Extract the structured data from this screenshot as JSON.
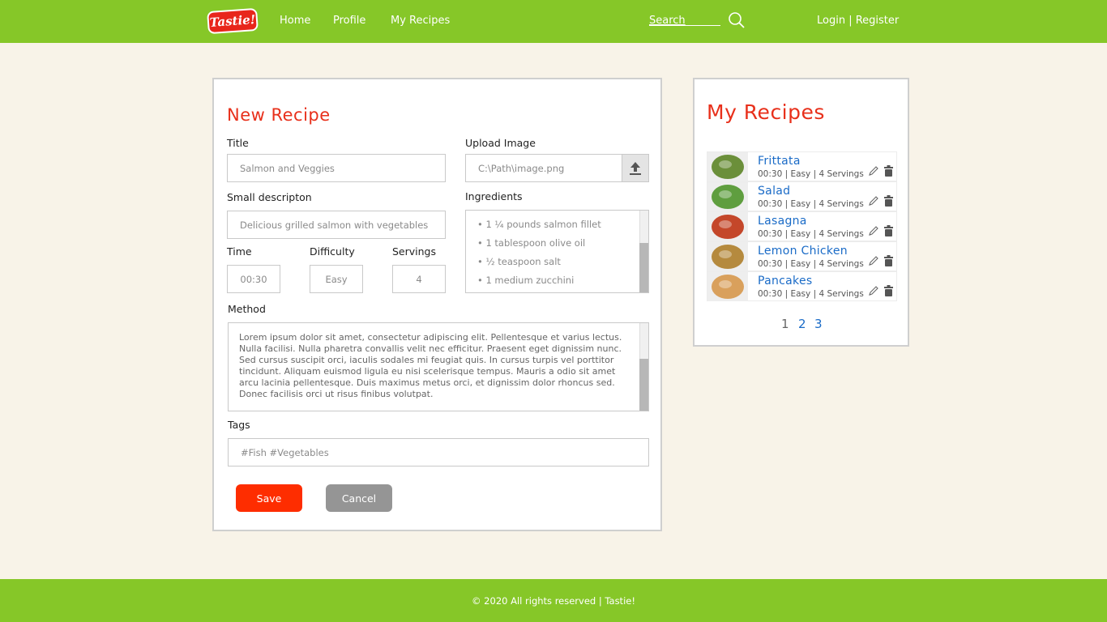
{
  "header": {
    "logo_text": "Tastie!",
    "nav": [
      "Home",
      "Profile",
      "My Recipes"
    ],
    "search_label": "Search",
    "auth": "Login | Register"
  },
  "form": {
    "heading": "New Recipe",
    "title_label": "Title",
    "title_value": "Salmon and Veggies",
    "upload_label": "Upload Image",
    "upload_value": "C:\\Path\\image.png",
    "desc_label": "Small descripton",
    "desc_value": "Delicious grilled salmon with vegetables",
    "ingredients_label": "Ingredients",
    "ingredients": [
      "• 1 ¼ pounds salmon fillet",
      "• 1 tablespoon olive oil",
      "• ½ teaspoon salt",
      "• 1 medium zucchini"
    ],
    "time_label": "Time",
    "time_value": "00:30",
    "difficulty_label": "Difficulty",
    "difficulty_value": "Easy",
    "servings_label": "Servings",
    "servings_value": "4",
    "method_label": "Method",
    "method_value": "Lorem ipsum dolor sit amet, consectetur adipiscing elit. Pellentesque et varius lectus. Nulla facilisi. Nulla pharetra convallis velit nec efficitur. Praesent eget dignissim nunc. Sed cursus suscipit orci, iaculis sodales mi feugiat quis. In cursus turpis vel porttitor tincidunt. Aliquam euismod ligula eu nisi scelerisque tempus. Mauris a odio sit amet arcu lacinia pellentesque. Duis maximus metus orci, et dignissim dolor rhoncus sed. Donec facilisis orci ut risus finibus volutpat.",
    "tags_label": "Tags",
    "tags_value": "#Fish #Vegetables",
    "save_label": "Save",
    "cancel_label": "Cancel"
  },
  "recipes": {
    "heading": "My Recipes",
    "items": [
      {
        "name": "Frittata",
        "meta": "00:30 | Easy | 4 Servings",
        "thumb_color": "#6b8f3a"
      },
      {
        "name": "Salad",
        "meta": "00:30 | Easy | 4 Servings",
        "thumb_color": "#5f9e3f"
      },
      {
        "name": "Lasagna",
        "meta": "00:30 | Easy | 4 Servings",
        "thumb_color": "#c4472a"
      },
      {
        "name": "Lemon Chicken",
        "meta": "00:30 | Easy | 4 Servings",
        "thumb_color": "#b58a3e"
      },
      {
        "name": "Pancakes",
        "meta": "00:30 | Easy | 4 Servings",
        "thumb_color": "#d9a05c"
      }
    ],
    "pages": [
      "1",
      "2",
      "3"
    ],
    "current_page": "1"
  },
  "footer": {
    "text": "© 2020 All rights reserved | Tastie!"
  },
  "colors": {
    "brand_green": "#86c728",
    "accent_red": "#e8301b",
    "save_red": "#fe2d00",
    "link_blue": "#1a6bc7",
    "background": "#f8f3e8"
  }
}
